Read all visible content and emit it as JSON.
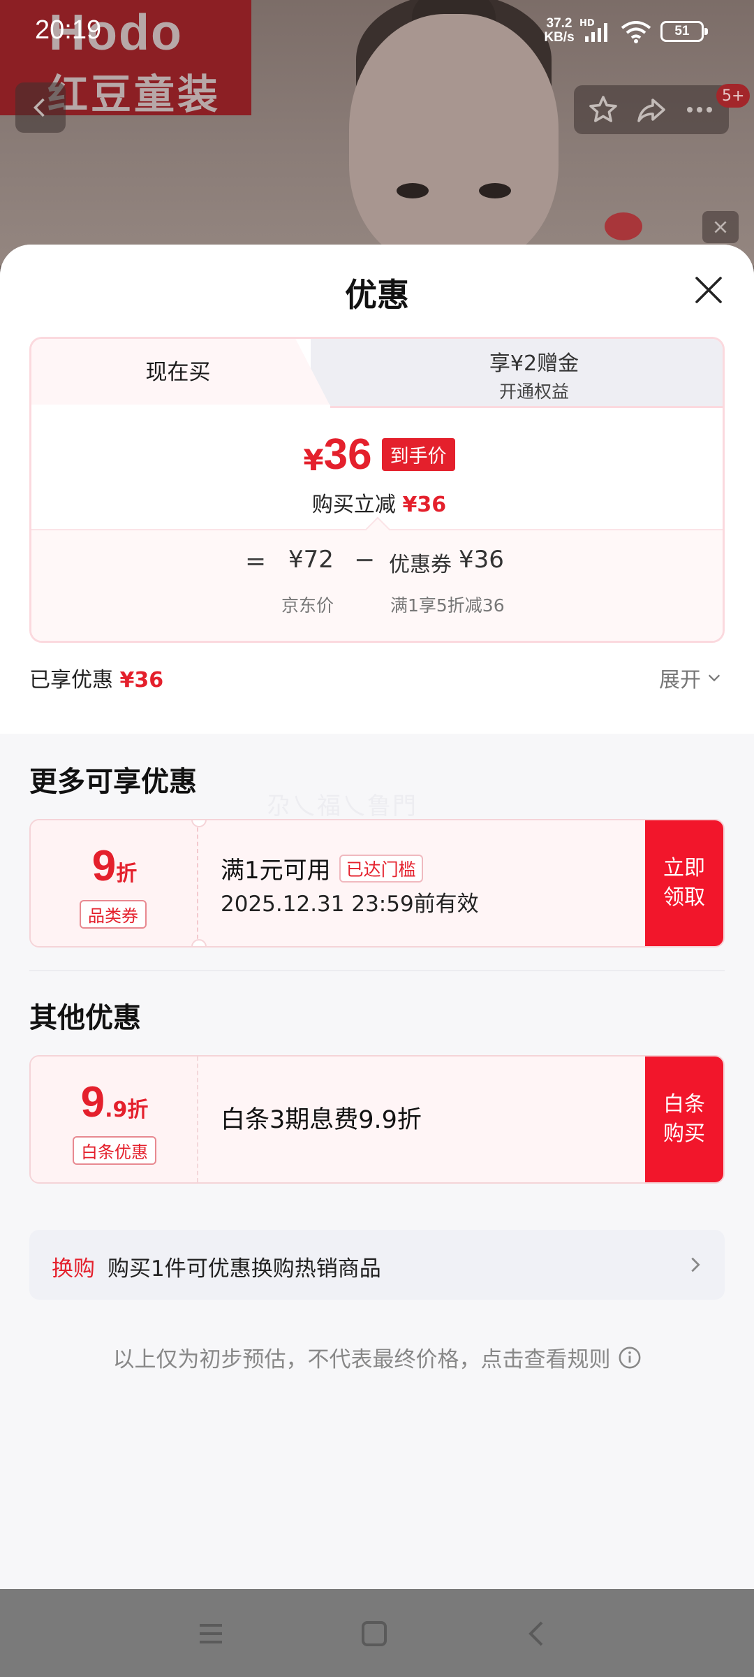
{
  "status_bar": {
    "time": "20:19",
    "net_speed_value": "37.2",
    "net_speed_unit": "KB/s",
    "hd": "HD",
    "battery": "51"
  },
  "background": {
    "brand_logo_line1": "Hodo",
    "brand_logo_line2": "红豆童装",
    "cart_badge": "5+"
  },
  "sheet": {
    "title": "优惠",
    "tabs": {
      "now_buy": "现在买",
      "bonus_title": "享¥2赠金",
      "bonus_sub": "开通权益"
    },
    "final_price": {
      "currency": "¥",
      "amount": "36",
      "tag": "到手价",
      "instant_label": "购买立减",
      "instant_amount": "¥36"
    },
    "breakdown": {
      "equals": "=",
      "original_price": "¥72",
      "minus": "−",
      "coupon_label": "优惠券",
      "coupon_amount": "¥36",
      "original_label": "京东价",
      "coupon_rule": "满1享5折减36"
    },
    "enjoyed": {
      "label": "已享优惠",
      "amount": "¥36",
      "expand": "展开"
    },
    "more_section": {
      "title": "更多可享优惠",
      "watermark": "尕乀福乀鲁門",
      "coupon": {
        "big": "9",
        "unit": "折",
        "chip": "品类券",
        "condition": "满1元可用",
        "status": "已达门槛",
        "validity": "2025.12.31 23:59前有效",
        "button_l1": "立即",
        "button_l2": "领取"
      }
    },
    "other_section": {
      "title": "其他优惠",
      "coupon": {
        "big": "9",
        "small": ".9折",
        "chip": "白条优惠",
        "text": "白条3期息费9.9折",
        "button_l1": "白条",
        "button_l2": "购买"
      }
    },
    "swap": {
      "tag": "换购",
      "text": "购买1件可优惠换购热销商品"
    },
    "disclaimer": "以上仅为初步预估，不代表最终价格，点击查看规则"
  },
  "colors": {
    "accent": "#e4202c",
    "button": "#f2162b",
    "sheet_bg": "#f7f7f9"
  }
}
